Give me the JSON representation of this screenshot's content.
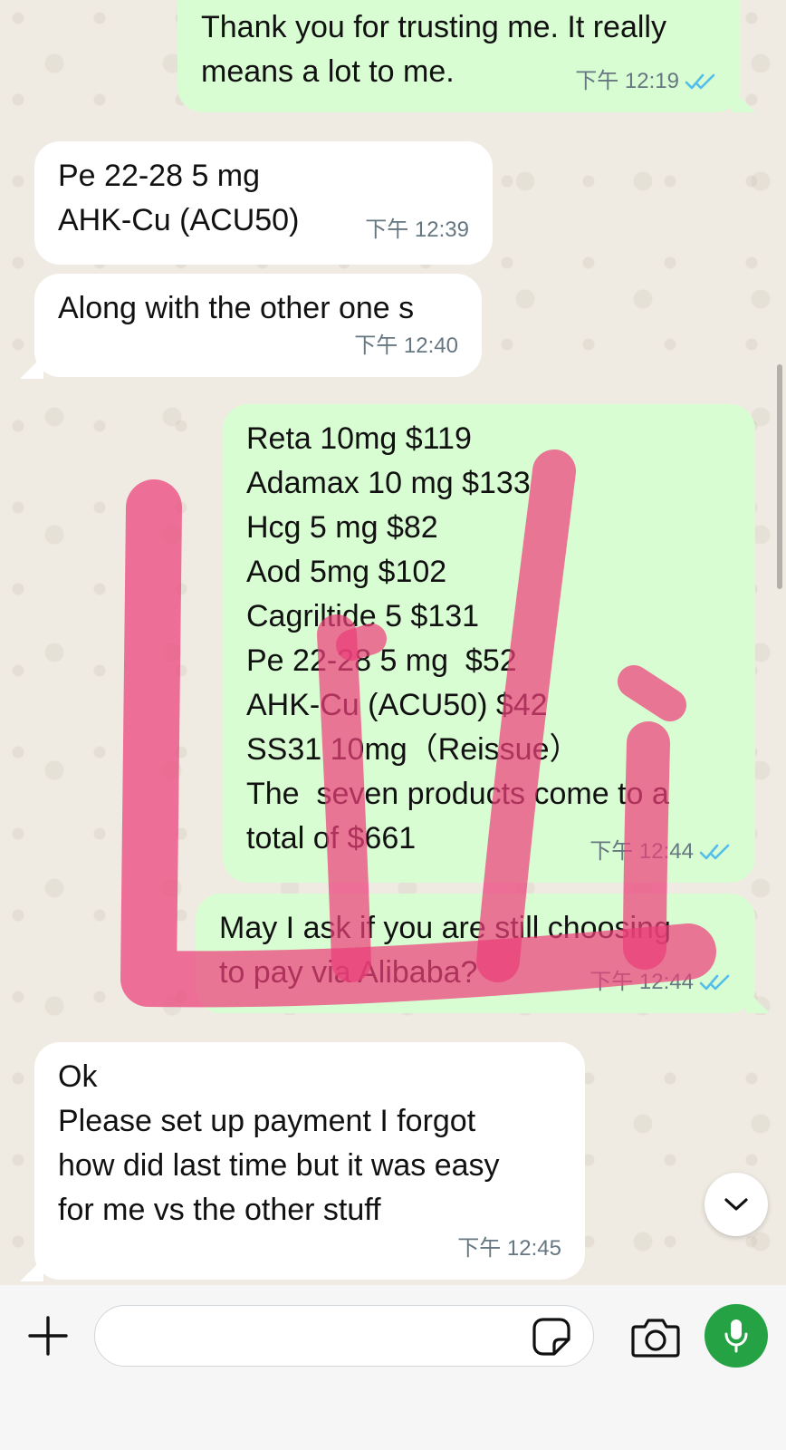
{
  "messages": [
    {
      "direction": "outgoing",
      "lines": [
        "Thank you for trusting me. It really",
        "means a lot to me."
      ],
      "time": "下午 12:19",
      "status": "read"
    },
    {
      "direction": "incoming",
      "lines": [
        "Pe 22-28 5 mg",
        "AHK-Cu (ACU50)"
      ],
      "time": "下午 12:39"
    },
    {
      "direction": "incoming",
      "lines": [
        "Along with the other one s"
      ],
      "time": "下午 12:40"
    },
    {
      "direction": "outgoing",
      "lines": [
        "Reta 10mg $119",
        "Adamax 10 mg $133",
        "Hcg 5 mg $82",
        "Aod 5mg $102",
        "Cagriltide 5 $131",
        "Pe 22-28 5 mg  $52",
        "AHK-Cu (ACU50) $42",
        "SS31 10mg（Reissue）",
        "The  seven products come to a",
        "total of $661"
      ],
      "time": "下午 12:44",
      "status": "read"
    },
    {
      "direction": "outgoing",
      "lines": [
        "May I ask if you are still choosing",
        "to pay via Alibaba?"
      ],
      "time": "下午 12:44",
      "status": "read"
    },
    {
      "direction": "incoming",
      "lines": [
        "Ok",
        "Please set up payment I forgot",
        "how did last time but it was easy",
        "for me vs the other stuff"
      ],
      "time": "下午 12:45"
    }
  ],
  "icons": {
    "read_receipt": "double-check-icon",
    "scroll_down": "chevron-down-icon",
    "attach": "plus-icon",
    "sticker": "sticker-icon",
    "camera": "camera-icon",
    "voice": "microphone-icon"
  },
  "colors": {
    "outgoing_bubble": "#d9fdd3",
    "incoming_bubble": "#ffffff",
    "read_tick": "#53bdeb",
    "mic_button": "#25a244",
    "watermark": "#ec407a"
  },
  "watermark_text": "Lili",
  "compose": {
    "value": "",
    "placeholder": ""
  }
}
